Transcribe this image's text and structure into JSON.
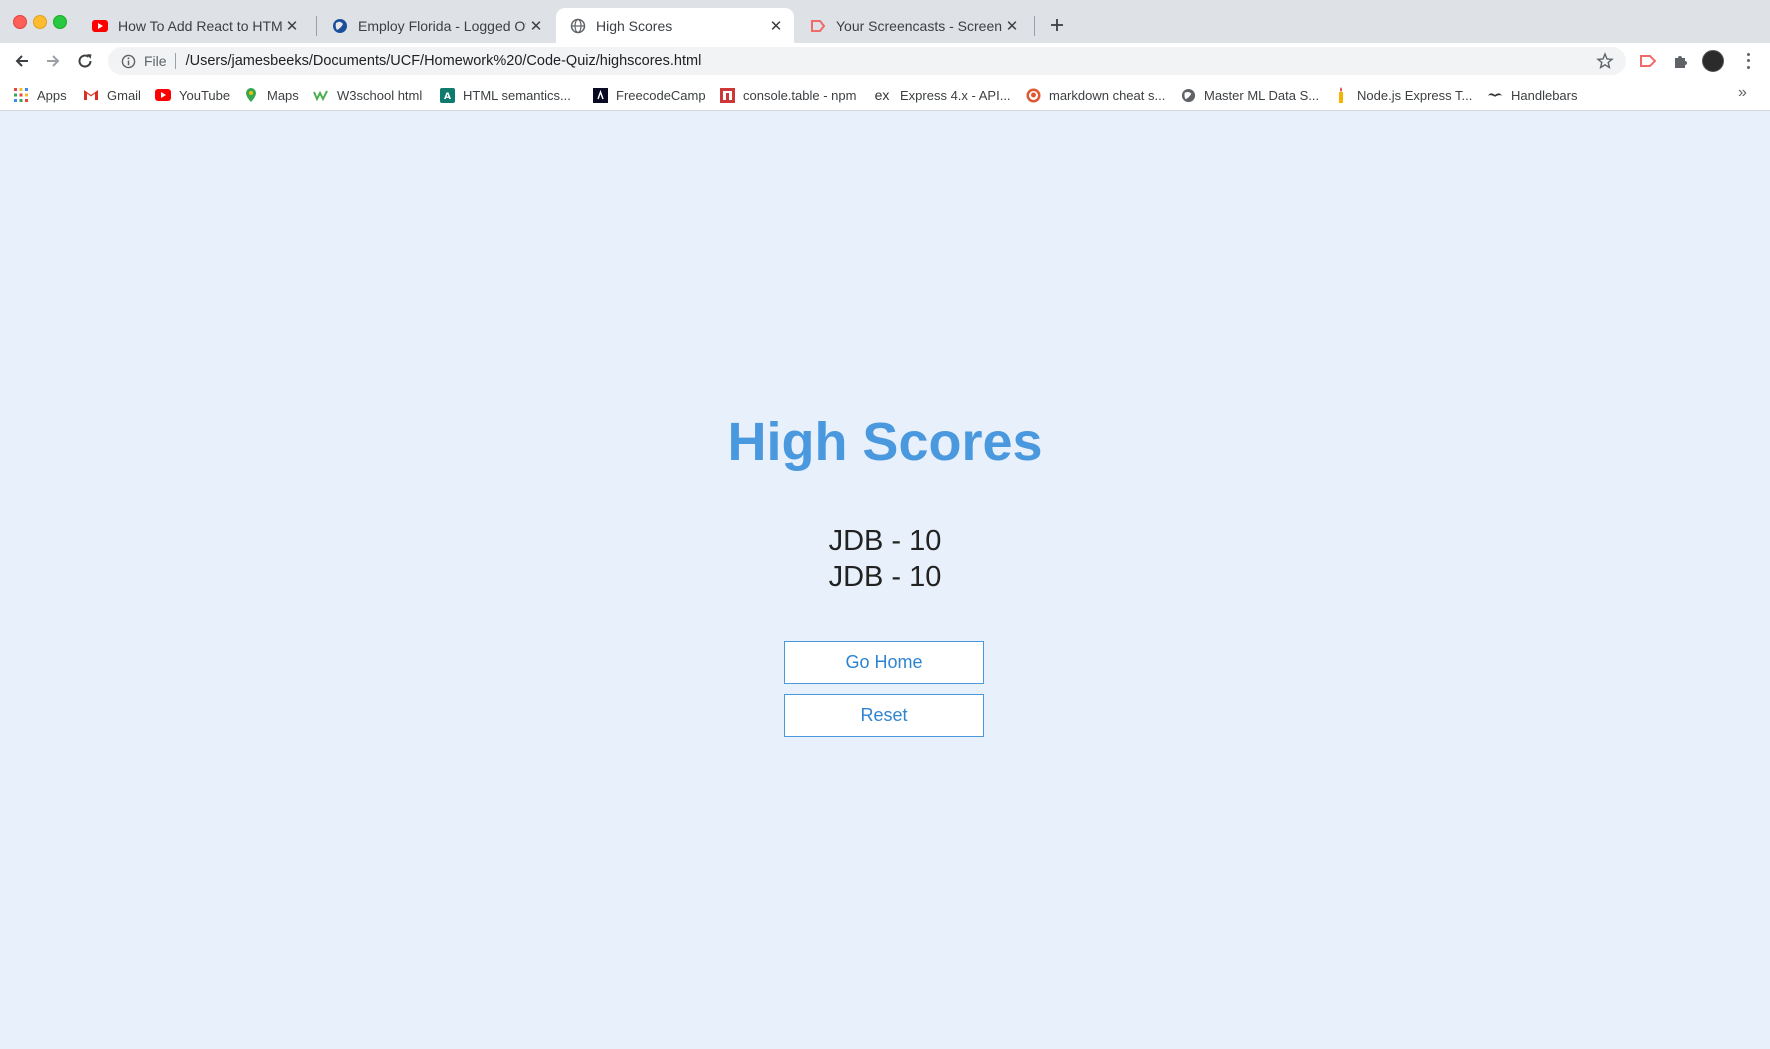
{
  "tabs": [
    {
      "title": "How To Add React to HTML We",
      "icon": "youtube-icon",
      "active": false
    },
    {
      "title": "Employ Florida - Logged Off",
      "icon": "globe-icon",
      "active": false
    },
    {
      "title": "High Scores",
      "icon": "globe-icon",
      "active": true
    },
    {
      "title": "Your Screencasts - Screencast",
      "icon": "screencastify-icon",
      "active": false
    }
  ],
  "omnibox": {
    "scheme": "File",
    "url": "/Users/jamesbeeks/Documents/UCF/Homework%20/Code-Quiz/highscores.html"
  },
  "bookmarks": [
    {
      "label": "Apps",
      "icon": "apps-grid-icon"
    },
    {
      "label": "Gmail",
      "icon": "gmail-icon"
    },
    {
      "label": "YouTube",
      "icon": "youtube-icon"
    },
    {
      "label": "Maps",
      "icon": "maps-icon"
    },
    {
      "label": "W3school html",
      "icon": "w3schools-icon"
    },
    {
      "label": "HTML semantics...",
      "icon": "html-semantics-icon"
    },
    {
      "label": "FreecodeCamp",
      "icon": "freecodecamp-icon"
    },
    {
      "label": "console.table - npm",
      "icon": "npm-icon"
    },
    {
      "label": "Express 4.x - API...",
      "icon": "express-icon"
    },
    {
      "label": "markdown cheat s...",
      "icon": "duckduckgo-icon"
    },
    {
      "label": "Master ML Data S...",
      "icon": "globe-icon"
    },
    {
      "label": "Node.js Express T...",
      "icon": "candle-icon"
    },
    {
      "label": "Handlebars",
      "icon": "handlebars-icon"
    }
  ],
  "page": {
    "title": "High Scores",
    "scores": [
      "JDB - 10",
      "JDB - 10"
    ],
    "go_home_label": "Go Home",
    "reset_label": "Reset"
  },
  "colors": {
    "page_background": "#e8f1fb",
    "accent": "#4a98de"
  }
}
